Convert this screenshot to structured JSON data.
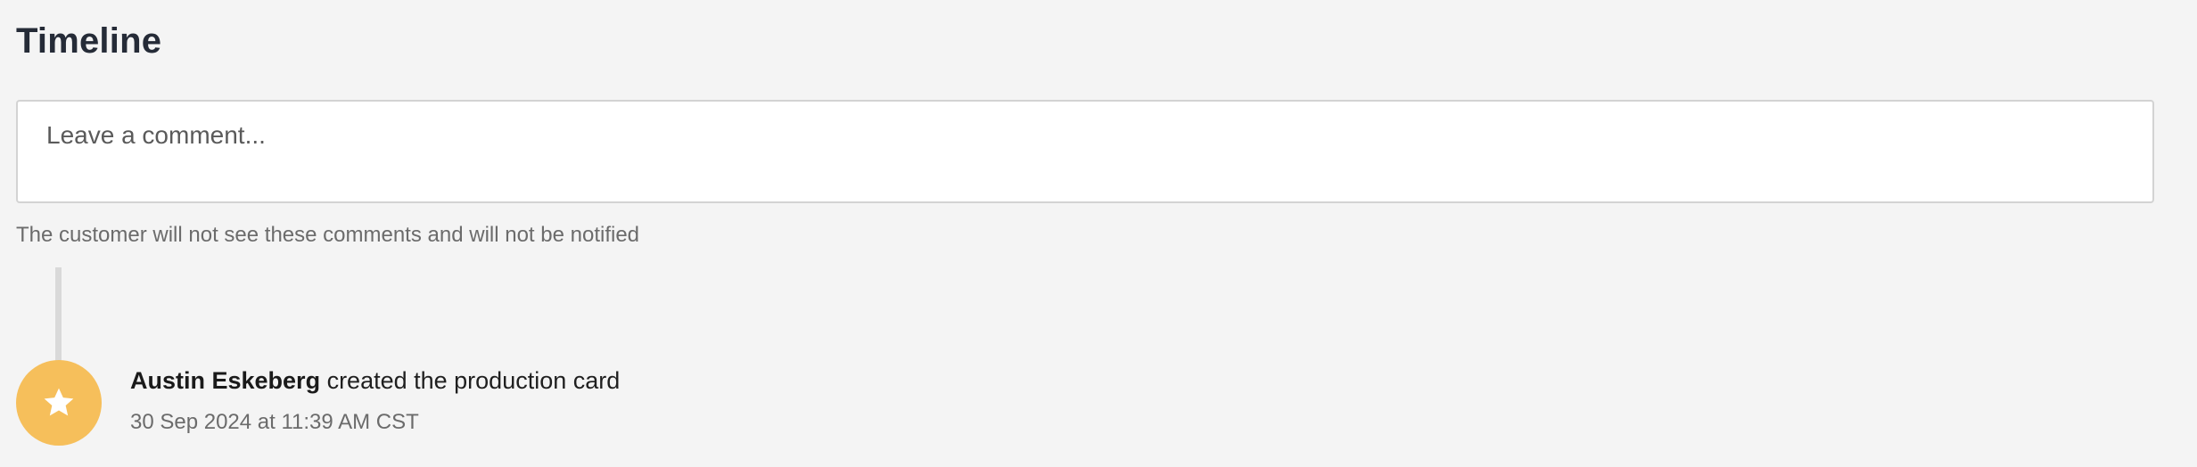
{
  "timeline": {
    "title": "Timeline",
    "comment": {
      "placeholder": "Leave a comment...",
      "value": ""
    },
    "help_text": "The customer will not see these comments and will not be notified",
    "events": [
      {
        "icon": "star-icon",
        "icon_bg_color": "#f6bf5b",
        "author": "Austin Eskeberg",
        "action": " created the production card",
        "timestamp": "30 Sep 2024 at 11:39 AM CST"
      }
    ]
  }
}
